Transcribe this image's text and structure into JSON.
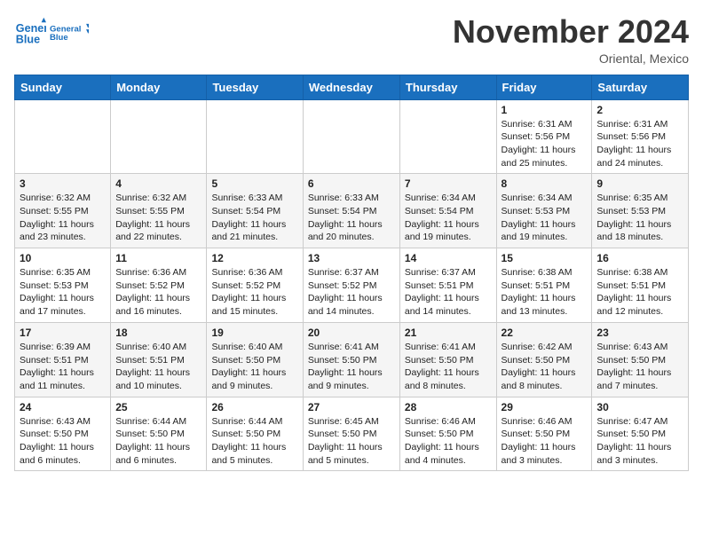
{
  "header": {
    "logo_line1": "General",
    "logo_line2": "Blue",
    "month_title": "November 2024",
    "location": "Oriental, Mexico"
  },
  "weekdays": [
    "Sunday",
    "Monday",
    "Tuesday",
    "Wednesday",
    "Thursday",
    "Friday",
    "Saturday"
  ],
  "weeks": [
    [
      {
        "day": "",
        "info": ""
      },
      {
        "day": "",
        "info": ""
      },
      {
        "day": "",
        "info": ""
      },
      {
        "day": "",
        "info": ""
      },
      {
        "day": "",
        "info": ""
      },
      {
        "day": "1",
        "info": "Sunrise: 6:31 AM\nSunset: 5:56 PM\nDaylight: 11 hours\nand 25 minutes."
      },
      {
        "day": "2",
        "info": "Sunrise: 6:31 AM\nSunset: 5:56 PM\nDaylight: 11 hours\nand 24 minutes."
      }
    ],
    [
      {
        "day": "3",
        "info": "Sunrise: 6:32 AM\nSunset: 5:55 PM\nDaylight: 11 hours\nand 23 minutes."
      },
      {
        "day": "4",
        "info": "Sunrise: 6:32 AM\nSunset: 5:55 PM\nDaylight: 11 hours\nand 22 minutes."
      },
      {
        "day": "5",
        "info": "Sunrise: 6:33 AM\nSunset: 5:54 PM\nDaylight: 11 hours\nand 21 minutes."
      },
      {
        "day": "6",
        "info": "Sunrise: 6:33 AM\nSunset: 5:54 PM\nDaylight: 11 hours\nand 20 minutes."
      },
      {
        "day": "7",
        "info": "Sunrise: 6:34 AM\nSunset: 5:54 PM\nDaylight: 11 hours\nand 19 minutes."
      },
      {
        "day": "8",
        "info": "Sunrise: 6:34 AM\nSunset: 5:53 PM\nDaylight: 11 hours\nand 19 minutes."
      },
      {
        "day": "9",
        "info": "Sunrise: 6:35 AM\nSunset: 5:53 PM\nDaylight: 11 hours\nand 18 minutes."
      }
    ],
    [
      {
        "day": "10",
        "info": "Sunrise: 6:35 AM\nSunset: 5:53 PM\nDaylight: 11 hours\nand 17 minutes."
      },
      {
        "day": "11",
        "info": "Sunrise: 6:36 AM\nSunset: 5:52 PM\nDaylight: 11 hours\nand 16 minutes."
      },
      {
        "day": "12",
        "info": "Sunrise: 6:36 AM\nSunset: 5:52 PM\nDaylight: 11 hours\nand 15 minutes."
      },
      {
        "day": "13",
        "info": "Sunrise: 6:37 AM\nSunset: 5:52 PM\nDaylight: 11 hours\nand 14 minutes."
      },
      {
        "day": "14",
        "info": "Sunrise: 6:37 AM\nSunset: 5:51 PM\nDaylight: 11 hours\nand 14 minutes."
      },
      {
        "day": "15",
        "info": "Sunrise: 6:38 AM\nSunset: 5:51 PM\nDaylight: 11 hours\nand 13 minutes."
      },
      {
        "day": "16",
        "info": "Sunrise: 6:38 AM\nSunset: 5:51 PM\nDaylight: 11 hours\nand 12 minutes."
      }
    ],
    [
      {
        "day": "17",
        "info": "Sunrise: 6:39 AM\nSunset: 5:51 PM\nDaylight: 11 hours\nand 11 minutes."
      },
      {
        "day": "18",
        "info": "Sunrise: 6:40 AM\nSunset: 5:51 PM\nDaylight: 11 hours\nand 10 minutes."
      },
      {
        "day": "19",
        "info": "Sunrise: 6:40 AM\nSunset: 5:50 PM\nDaylight: 11 hours\nand 9 minutes."
      },
      {
        "day": "20",
        "info": "Sunrise: 6:41 AM\nSunset: 5:50 PM\nDaylight: 11 hours\nand 9 minutes."
      },
      {
        "day": "21",
        "info": "Sunrise: 6:41 AM\nSunset: 5:50 PM\nDaylight: 11 hours\nand 8 minutes."
      },
      {
        "day": "22",
        "info": "Sunrise: 6:42 AM\nSunset: 5:50 PM\nDaylight: 11 hours\nand 8 minutes."
      },
      {
        "day": "23",
        "info": "Sunrise: 6:43 AM\nSunset: 5:50 PM\nDaylight: 11 hours\nand 7 minutes."
      }
    ],
    [
      {
        "day": "24",
        "info": "Sunrise: 6:43 AM\nSunset: 5:50 PM\nDaylight: 11 hours\nand 6 minutes."
      },
      {
        "day": "25",
        "info": "Sunrise: 6:44 AM\nSunset: 5:50 PM\nDaylight: 11 hours\nand 6 minutes."
      },
      {
        "day": "26",
        "info": "Sunrise: 6:44 AM\nSunset: 5:50 PM\nDaylight: 11 hours\nand 5 minutes."
      },
      {
        "day": "27",
        "info": "Sunrise: 6:45 AM\nSunset: 5:50 PM\nDaylight: 11 hours\nand 5 minutes."
      },
      {
        "day": "28",
        "info": "Sunrise: 6:46 AM\nSunset: 5:50 PM\nDaylight: 11 hours\nand 4 minutes."
      },
      {
        "day": "29",
        "info": "Sunrise: 6:46 AM\nSunset: 5:50 PM\nDaylight: 11 hours\nand 3 minutes."
      },
      {
        "day": "30",
        "info": "Sunrise: 6:47 AM\nSunset: 5:50 PM\nDaylight: 11 hours\nand 3 minutes."
      }
    ]
  ]
}
